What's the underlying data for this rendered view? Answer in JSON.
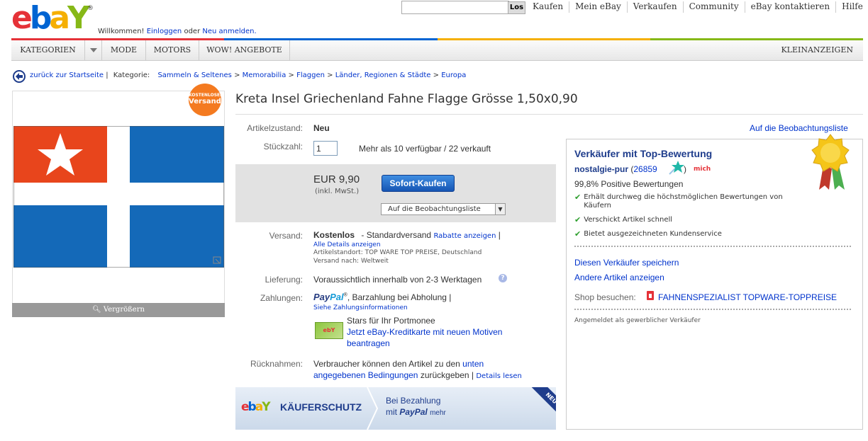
{
  "header": {
    "logo_letters": [
      "e",
      "b",
      "a",
      "Y"
    ],
    "logo_reg": "®",
    "welcome_text": "Willkommen!",
    "login_link": "Einloggen",
    "or_text": "oder",
    "register_link": "Neu anmelden.",
    "search_button": "Los",
    "search_value": "",
    "nav": [
      "Kaufen",
      "Mein eBay",
      "Verkaufen",
      "Community",
      "eBay kontaktieren",
      "Hilfe"
    ],
    "colorbar": [
      "#e53238",
      "#0064d2",
      "#f5af02",
      "#86b817"
    ]
  },
  "categories": {
    "dropdown_label": "KATEGORIEN",
    "items": [
      "MODE",
      "MOTORS",
      "WOW! ANGEBOTE"
    ],
    "right_link": "KLEINANZEIGEN"
  },
  "breadcrumb": {
    "back_link": "zurück zur Startseite",
    "separator": "|",
    "category_label": "Kategorie:",
    "path": [
      "Sammeln & Seltenes",
      "Memorabilia",
      "Flaggen",
      "Länder, Regionen & Städte",
      "Europa"
    ],
    "path_sep": ">"
  },
  "image_panel": {
    "badge_line1": "KOSTENLOSER",
    "badge_line2": "Versand",
    "enlarge_label": "Vergrößern",
    "flag_colors": {
      "canton": "#e8451c",
      "field": "#1469b8",
      "cross": "#ffffff"
    }
  },
  "item": {
    "title": "Kreta Insel Griechenland Fahne Flagge Grösse 1,50x0,90",
    "watchlist_link": "Auf die Beobachtungsliste",
    "condition_label": "Artikelzustand:",
    "condition_value": "Neu",
    "quantity_label": "Stückzahl:",
    "quantity_value": "1",
    "availability": "Mehr als 10 verfügbar / 22 verkauft",
    "price": "EUR 9,90",
    "price_note": "(inkl. MwSt.)",
    "buy_now": "Sofort-Kaufen",
    "watch_dropdown": "Auf die Beobachtungsliste"
  },
  "shipping": {
    "label": "Versand:",
    "cost": "Kostenlos",
    "method": "- Standardversand",
    "discount_link": "Rabatte anzeigen",
    "pipe": "|",
    "details_link": "Alle Details anzeigen",
    "location": "Artikelstandort: TOP WARE TOP PREISE, Deutschland",
    "ships_to": "Versand nach: Weltweit"
  },
  "delivery": {
    "label": "Lieferung:",
    "value": "Voraussichtlich innerhalb von 2-3 Werktagen",
    "help_icon": "?"
  },
  "payment": {
    "label": "Zahlungen:",
    "paypal_1": "Pay",
    "paypal_2": "Pal",
    "tm": "®",
    "other": ", Barzahlung bei Abholung |",
    "info_link": "Siehe Zahlungsinformationen",
    "card_label": "ebY",
    "card_promo_1": "Stars für Ihr Portmonee",
    "card_promo_2": "Jetzt eBay-Kreditkarte mit neuen Motiven",
    "card_promo_3": "beantragen"
  },
  "returns": {
    "label": "Rücknahmen:",
    "text_1": "Verbraucher können den Artikel zu den",
    "link_1": "unten",
    "link_2": "angegebenen Bedingungen",
    "text_2": "zurückgeben |",
    "details_link": "Details lesen"
  },
  "buyer_protection": {
    "logo_letters": [
      "e",
      "b",
      "a",
      "Y"
    ],
    "title": "KÄUFERSCHUTZ",
    "line1": "Bei Bezahlung",
    "line2_prefix": "mit",
    "paypal": "PayPal",
    "more": "mehr",
    "ribbon": "NEU"
  },
  "seller": {
    "heading": "Verkäufer mit Top-Bewertung",
    "name": "nostalgie-pur",
    "paren_open": "(",
    "score": "26859",
    "paren_close": ")",
    "me_badge": "mich",
    "positive": "99,8% Positive Bewertungen",
    "badges": [
      "Erhält durchweg die höchstmöglichen Bewertungen von Käufern",
      "Verschickt Artikel schnell",
      "Bietet ausgezeichneten Kundenservice"
    ],
    "save_link": "Diesen Verkäufer speichern",
    "other_items_link": "Andere Artikel anzeigen",
    "shop_label": "Shop besuchen:",
    "shop_name": "FAHNENSPEZIALIST TOPWARE-TOPPREISE",
    "business_note": "Angemeldet als gewerblicher Verkäufer"
  }
}
